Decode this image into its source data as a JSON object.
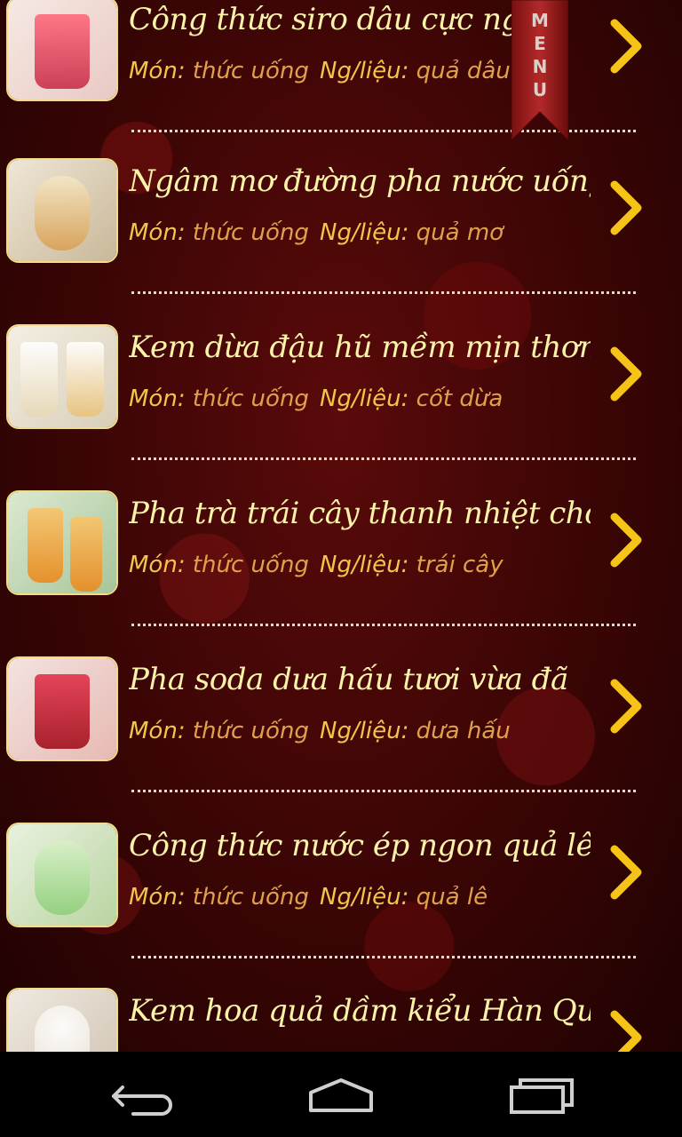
{
  "menu": {
    "label": "MENU",
    "letters": [
      "M",
      "E",
      "N",
      "U"
    ]
  },
  "labels": {
    "mon": "Món:",
    "nglieu": "Ng/liệu:"
  },
  "items": [
    {
      "title": "Công thức siro dâu cực ngon",
      "mon": "thức uống",
      "nglieu": "quả dâu",
      "thumb_icon": "strawberry-drink-image",
      "color": "#c8304a"
    },
    {
      "title": "Ngâm mơ đường pha nước uống",
      "mon": "thức uống",
      "nglieu": "quả mơ",
      "thumb_icon": "apricot-drink-image",
      "color": "#d9a055"
    },
    {
      "title": "Kem dừa đậu hũ mềm mịn thơm",
      "mon": "thức uống",
      "nglieu": "cốt dừa",
      "thumb_icon": "coconut-ice-cream-image",
      "color": "#efe6d2"
    },
    {
      "title": "Pha trà trái cây thanh nhiệt cho",
      "mon": "thức uống",
      "nglieu": "trái cây",
      "thumb_icon": "fruit-tea-image",
      "color": "#e98a1e"
    },
    {
      "title": "Pha soda dưa hấu tươi vừa đã",
      "mon": "thức uống",
      "nglieu": "dưa hấu",
      "thumb_icon": "watermelon-soda-image",
      "color": "#c01a2a"
    },
    {
      "title": "Công thức nước ép ngon quả lê +",
      "mon": "thức uống",
      "nglieu": "quả lê",
      "thumb_icon": "pear-juice-image",
      "color": "#8fcf7a"
    },
    {
      "title": "Kem hoa quả dầm kiểu Hàn Quốc",
      "mon": "",
      "nglieu": "",
      "thumb_icon": "korean-fruit-ice-image",
      "color": "#e9e0d4"
    }
  ],
  "nav": {
    "back": "back-icon",
    "home": "home-icon",
    "recents": "recents-icon"
  },
  "colors": {
    "title": "#fbf3a8",
    "label": "#f2c64a",
    "value": "#e0a14a",
    "chevron": "#f5c416",
    "accent_border": "#f2dc8a"
  }
}
